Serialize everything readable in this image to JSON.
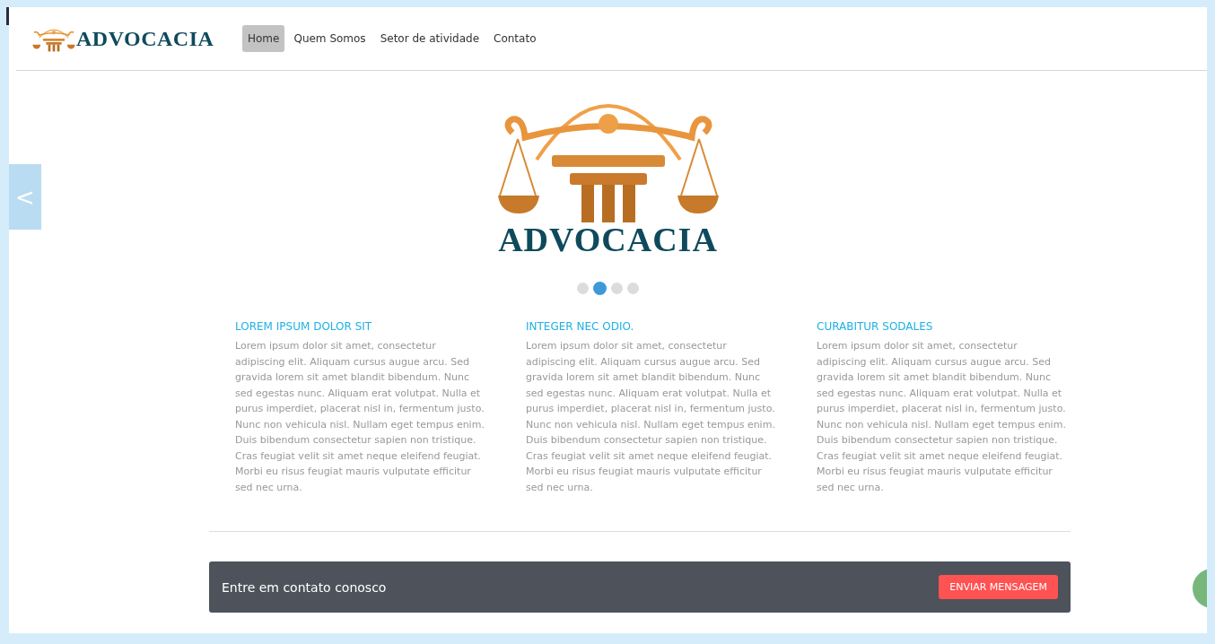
{
  "header": {
    "logo_text": "ADVOCACIA",
    "nav": [
      {
        "label": "Home",
        "selected": true
      },
      {
        "label": "Quem Somos",
        "selected": false
      },
      {
        "label": "Setor de atividade",
        "selected": false
      },
      {
        "label": "Contato",
        "selected": false
      }
    ]
  },
  "carousel": {
    "prev": "<",
    "logo_text": "ADVOCACIA",
    "dots": [
      {
        "selected": false
      },
      {
        "selected": true
      },
      {
        "selected": false
      },
      {
        "selected": false
      }
    ]
  },
  "features": [
    {
      "title": "LOREM IPSUM DOLOR SIT",
      "text": "Lorem ipsum dolor sit amet, consectetur adipiscing elit. Aliquam cursus augue arcu. Sed gravida lorem sit amet blandit bibendum. Nunc sed egestas nunc. Aliquam erat volutpat. Nulla et purus imperdiet, placerat nisl in, fermentum justo. Nunc non vehicula nisl. Nullam eget tempus enim. Duis bibendum consectetur sapien non tristique. Cras feugiat velit sit amet neque eleifend feugiat. Morbi eu risus feugiat mauris vulputate efficitur sed nec urna."
    },
    {
      "title": "INTEGER NEC ODIO.",
      "text": "Lorem ipsum dolor sit amet, consectetur adipiscing elit. Aliquam cursus augue arcu. Sed gravida lorem sit amet blandit bibendum. Nunc sed egestas nunc. Aliquam erat volutpat. Nulla et purus imperdiet, placerat nisl in, fermentum justo. Nunc non vehicula nisl. Nullam eget tempus enim. Duis bibendum consectetur sapien non tristique. Cras feugiat velit sit amet neque eleifend feugiat. Morbi eu risus feugiat mauris vulputate efficitur sed nec urna."
    },
    {
      "title": "CURABITUR SODALES",
      "text": "Lorem ipsum dolor sit amet, consectetur adipiscing elit. Aliquam cursus augue arcu. Sed gravida lorem sit amet blandit bibendum. Nunc sed egestas nunc. Aliquam erat volutpat. Nulla et purus imperdiet, placerat nisl in, fermentum justo. Nunc non vehicula nisl. Nullam eget tempus enim. Duis bibendum consectetur sapien non tristique. Cras feugiat velit sit amet neque eleifend feugiat. Morbi eu risus feugiat mauris vulputate efficitur sed nec urna."
    }
  ],
  "contact_bar": {
    "text": "Entre em contato conosco",
    "button": "ENVIAR MENSAGEM"
  }
}
